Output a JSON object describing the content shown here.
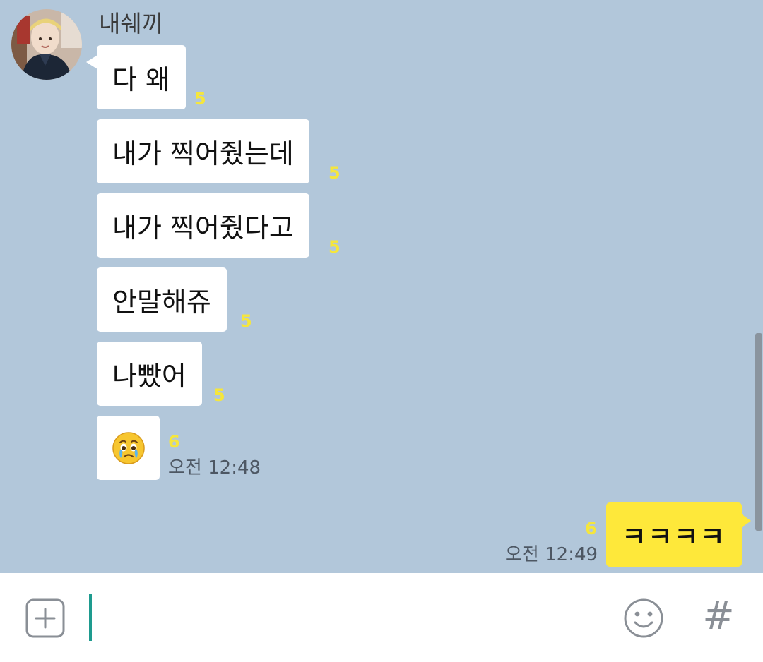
{
  "chat": {
    "sender_name": "내쉐끼",
    "incoming": [
      {
        "text": "다 왜",
        "unread": "5"
      },
      {
        "text": "내가 찍어줬는데",
        "unread": "5"
      },
      {
        "text": "내가 찍어줬다고",
        "unread": "5"
      },
      {
        "text": "안말해쥬",
        "unread": "5"
      },
      {
        "text": "나빴어",
        "unread": "5"
      }
    ],
    "emoji_message": {
      "icon": "crying-face-emoji",
      "unread": "6",
      "time": "오전 12:48"
    },
    "outgoing": {
      "text": "ㅋㅋㅋㅋ",
      "unread": "6",
      "time": "오전 12:49"
    }
  },
  "input_bar": {
    "value": "",
    "icons": {
      "add": "plus-square-icon",
      "emoticon": "smiley-face-icon",
      "hashtag": "hashtag-icon"
    },
    "hashtag_glyph": "#"
  },
  "colors": {
    "chat_background": "#b2c7da",
    "incoming_bubble": "#ffffff",
    "outgoing_bubble": "#fee83a",
    "unread_count": "#f5e63c",
    "cursor": "#1e9b8f"
  }
}
